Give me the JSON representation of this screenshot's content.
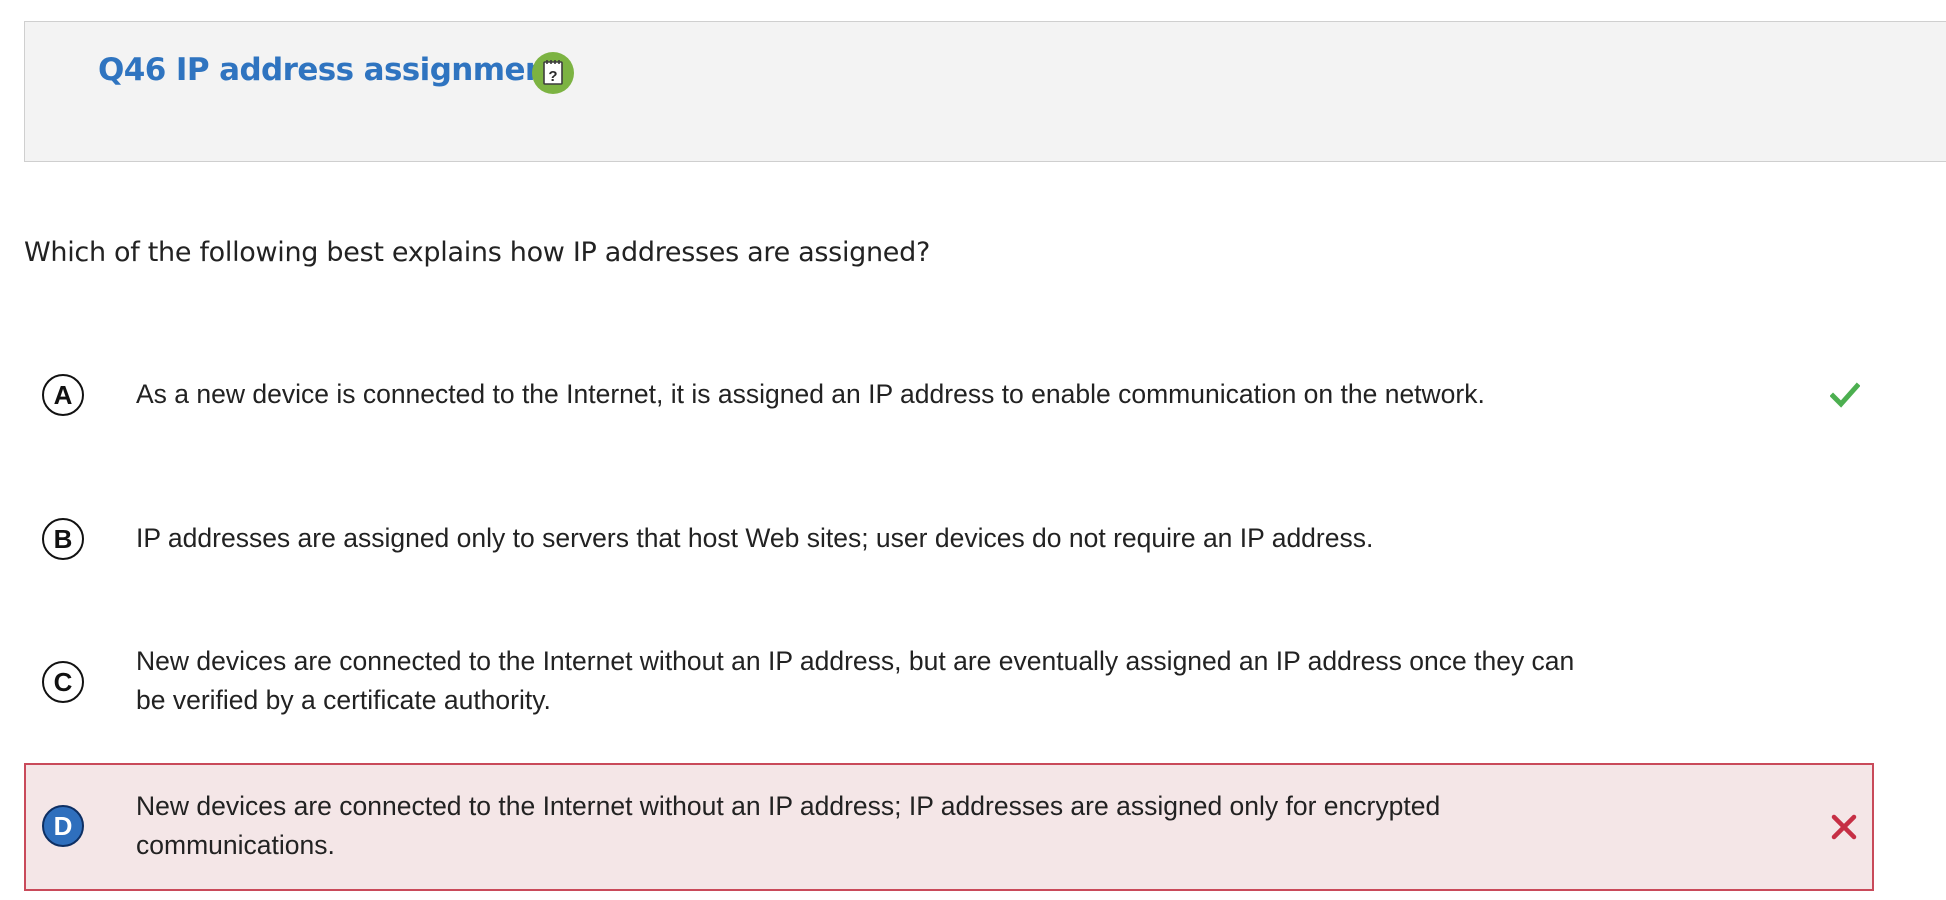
{
  "question": {
    "title": "Q46 IP address assignment",
    "help_icon": "help-notepad-icon",
    "prompt": "Which of the following best explains how IP addresses are assigned?"
  },
  "choices": [
    {
      "letter": "A",
      "text": "As a new device is connected to the Internet, it is assigned an IP address to enable communication on the network.",
      "status": "correct",
      "selected": false
    },
    {
      "letter": "B",
      "text": "IP addresses are assigned only to servers that host Web sites; user devices do not require an IP address.",
      "status": "none",
      "selected": false
    },
    {
      "letter": "C",
      "text": "New devices are connected to the Internet without an IP address, but are eventually assigned an IP address once they can be verified by a certificate authority.",
      "status": "none",
      "selected": false
    },
    {
      "letter": "D",
      "text": "New devices are connected to the Internet without an IP address; IP addresses are assigned only for encrypted communications.",
      "status": "incorrect",
      "selected": true
    }
  ],
  "colors": {
    "title_blue": "#2f74c0",
    "help_green": "#7cb342",
    "correct_green": "#4caf50",
    "incorrect_red": "#c62f45",
    "selected_blue": "#2f6fbd",
    "wrong_bg": "#f4e6e7"
  }
}
